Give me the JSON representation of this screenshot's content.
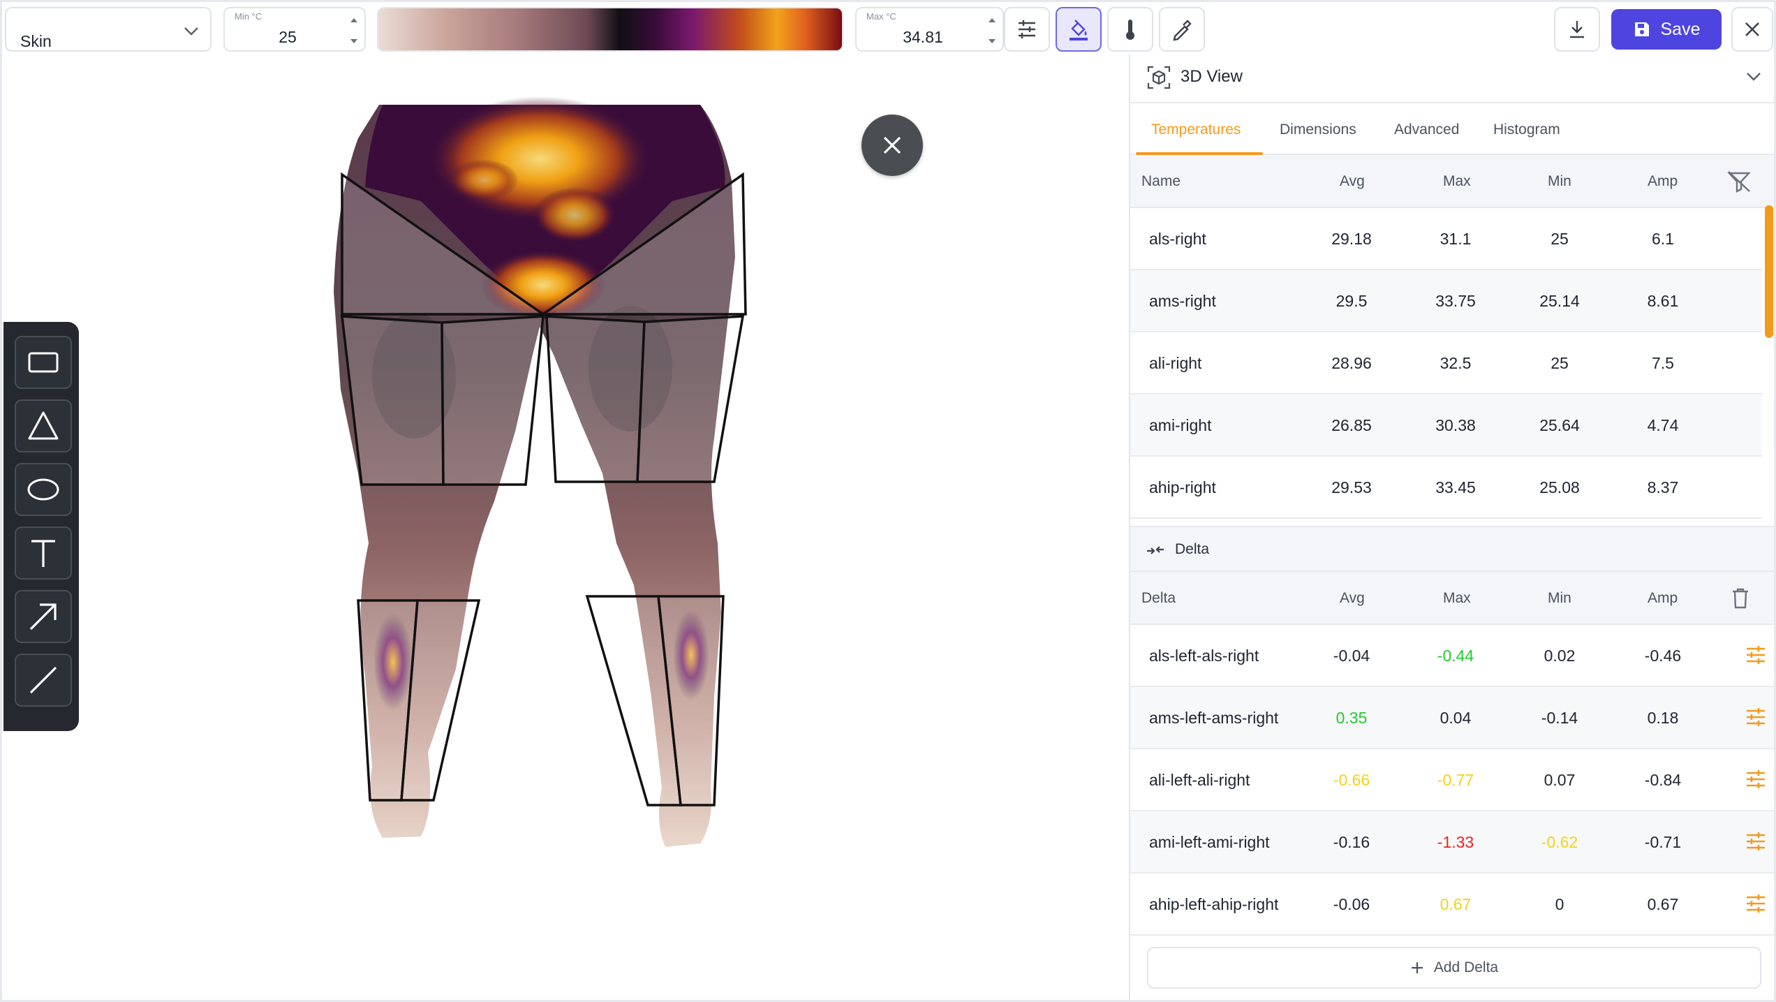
{
  "toolbar": {
    "palette_select": "Skin",
    "min_label": "Min °C",
    "min_value": "25",
    "max_label": "Max °C",
    "max_value": "34.81",
    "save_label": "Save"
  },
  "panel": {
    "title": "3D View",
    "tabs": [
      "Temperatures",
      "Dimensions",
      "Advanced",
      "Histogram"
    ],
    "active_tab": "Temperatures",
    "temperatures": {
      "headers": {
        "name": "Name",
        "avg": "Avg",
        "max": "Max",
        "min": "Min",
        "amp": "Amp"
      },
      "rows": [
        {
          "name": "als-right",
          "avg": "29.18",
          "max": "31.1",
          "min": "25",
          "amp": "6.1"
        },
        {
          "name": "ams-right",
          "avg": "29.5",
          "max": "33.75",
          "min": "25.14",
          "amp": "8.61"
        },
        {
          "name": "ali-right",
          "avg": "28.96",
          "max": "32.5",
          "min": "25",
          "amp": "7.5"
        },
        {
          "name": "ami-right",
          "avg": "26.85",
          "max": "30.38",
          "min": "25.64",
          "amp": "4.74"
        },
        {
          "name": "ahip-right",
          "avg": "29.53",
          "max": "33.45",
          "min": "25.08",
          "amp": "8.37"
        }
      ]
    },
    "delta": {
      "title": "Delta",
      "headers": {
        "name": "Delta",
        "avg": "Avg",
        "max": "Max",
        "min": "Min",
        "amp": "Amp"
      },
      "rows": [
        {
          "name": "als-left-als-right",
          "avg": "-0.04",
          "max": "-0.44",
          "min": "0.02",
          "amp": "-0.46"
        },
        {
          "name": "ams-left-ams-right",
          "avg": "0.35",
          "max": "0.04",
          "min": "-0.14",
          "amp": "0.18"
        },
        {
          "name": "ali-left-ali-right",
          "avg": "-0.66",
          "max": "-0.77",
          "min": "0.07",
          "amp": "-0.84"
        },
        {
          "name": "ami-left-ami-right",
          "avg": "-0.16",
          "max": "-1.33",
          "min": "-0.62",
          "amp": "-0.71"
        },
        {
          "name": "ahip-left-ahip-right",
          "avg": "-0.06",
          "max": "0.67",
          "min": "0",
          "amp": "0.67"
        }
      ],
      "add_label": "Add Delta"
    }
  },
  "colors": {
    "accent": "#f39a1c",
    "primary": "#4e45e0",
    "delta_green": "#22c92f",
    "delta_yellow": "#f2d21b",
    "delta_red": "#ee2222"
  },
  "icons": {
    "tools": [
      "rectangle-icon",
      "triangle-icon",
      "ellipse-icon",
      "text-icon",
      "arrow-icon",
      "line-icon"
    ],
    "toolbar": [
      "sliders-icon",
      "paint-bucket-icon",
      "thermometer-icon",
      "eyedropper-icon",
      "download-icon",
      "save-icon",
      "close-icon"
    ]
  }
}
